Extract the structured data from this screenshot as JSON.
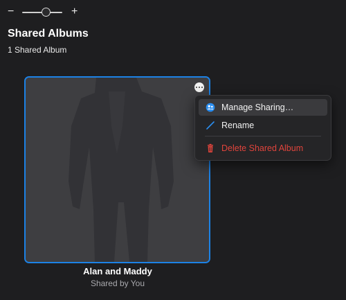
{
  "zoom": {
    "minus_label": "−",
    "plus_label": "+",
    "level": 0.6
  },
  "header": {
    "title": "Shared Albums",
    "subtitle": "1 Shared Album"
  },
  "album": {
    "name": "Alan and Maddy",
    "owner": "Shared by You",
    "selected": true,
    "selection_color": "#1c82e6",
    "more_icon": "ellipsis-circle-icon"
  },
  "context_menu": {
    "items": [
      {
        "label": "Manage Sharing…",
        "icon": "shared-people-icon",
        "icon_color": "#2b8ef0",
        "hovered": true
      },
      {
        "label": "Rename",
        "icon": "pencil-icon",
        "icon_color": "#2b8ef0",
        "hovered": false
      },
      {
        "label": "Delete Shared Album",
        "icon": "trash-icon",
        "icon_color": "#e0443c",
        "destructive": true
      }
    ]
  }
}
